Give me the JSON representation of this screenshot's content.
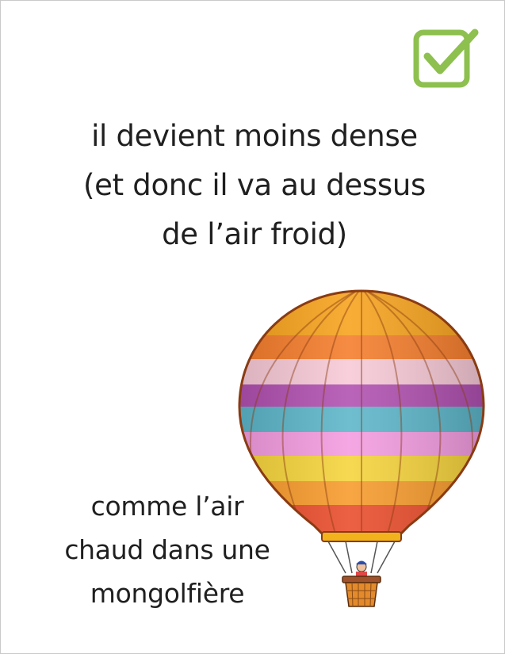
{
  "card": {
    "main_lines": [
      "il devient moins dense",
      "(et donc il va au dessus",
      "de l’air froid)"
    ],
    "sub_lines": [
      "comme l’air",
      "chaud dans une",
      "mongolfière"
    ]
  },
  "icons": {
    "check": "checkbox-checked-icon",
    "balloon": "hot-air-balloon-illustration"
  },
  "colors": {
    "check_green": "#8dc04f",
    "text": "#1f1f1f"
  }
}
